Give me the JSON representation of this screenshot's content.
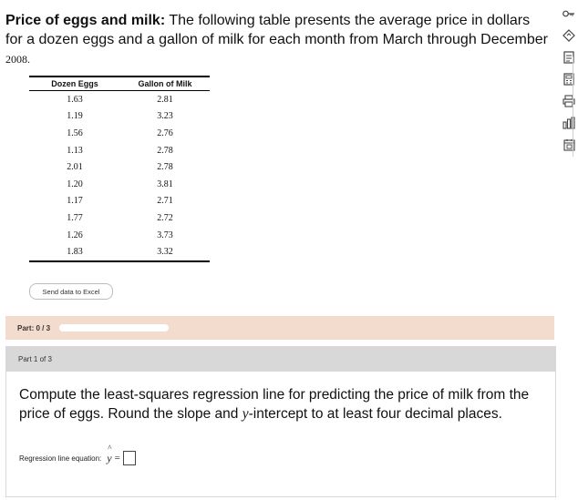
{
  "problem": {
    "title": "Price of eggs and milk:",
    "text": "The following table presents the average price in dollars for a dozen eggs and a gallon of milk for each month from March through December",
    "year": "2008."
  },
  "table": {
    "headers": [
      "Dozen Eggs",
      "Gallon of Milk"
    ],
    "rows": [
      [
        "1.63",
        "2.81"
      ],
      [
        "1.19",
        "3.23"
      ],
      [
        "1.56",
        "2.76"
      ],
      [
        "1.13",
        "2.78"
      ],
      [
        "2.01",
        "2.78"
      ],
      [
        "1.20",
        "3.81"
      ],
      [
        "1.17",
        "2.71"
      ],
      [
        "1.77",
        "2.72"
      ],
      [
        "1.26",
        "3.73"
      ],
      [
        "1.83",
        "3.32"
      ]
    ]
  },
  "excel_button": "Send data to Excel",
  "progress": {
    "label": "Part:",
    "value": "0 / 3",
    "fraction": 0.0
  },
  "part": {
    "header": "Part 1 of 3",
    "question_pre": "Compute the least-squares regression line for predicting the price of milk from the price of eggs. Round the slope and ",
    "question_var": "y",
    "question_post": "-intercept to at least four decimal places.",
    "answer_label": "Regression line equation:",
    "answer_var": "y",
    "answer_eq": "="
  },
  "toolbar": {
    "icons": [
      "key-icon",
      "diamond-icon",
      "document-icon",
      "calculator-icon",
      "printer-icon",
      "chart-icon",
      "calendar-icon"
    ]
  },
  "colors": {
    "part_bar": "#f3dccd",
    "part_header": "#d8d8d8"
  }
}
